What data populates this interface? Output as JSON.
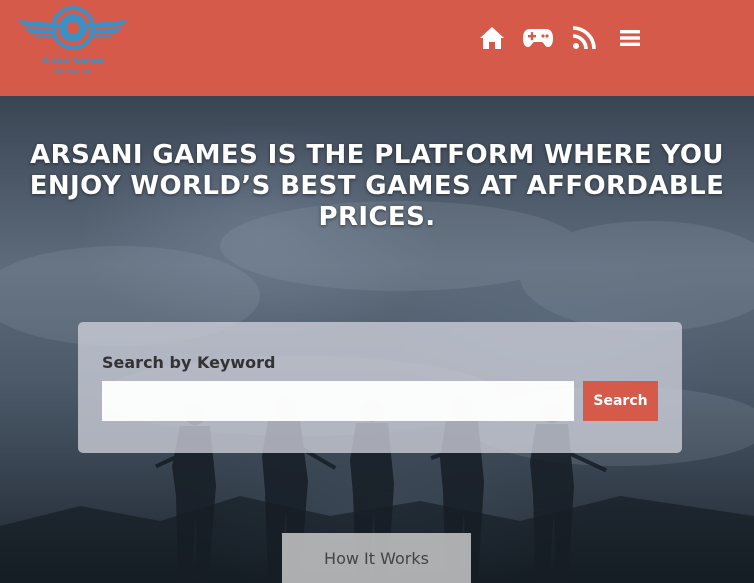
{
  "header": {
    "logo": {
      "name_line1": "Arsani Games",
      "name_line2": "Games Inc",
      "initial": "G"
    },
    "nav": [
      {
        "icon": "home-icon"
      },
      {
        "icon": "gamepad-icon"
      },
      {
        "icon": "rss-icon"
      },
      {
        "icon": "menu-icon"
      }
    ],
    "background_color": "#d65a4a"
  },
  "hero": {
    "tagline": "ARSANI GAMES IS THE PLATFORM WHERE YOU ENJOY WORLD’S BEST GAMES AT AFFORDABLE PRICES."
  },
  "search": {
    "label": "Search by Keyword",
    "input_value": "",
    "placeholder": "",
    "button_label": "Search",
    "button_color": "#d65a4a"
  },
  "how_it_works": {
    "label": "How It Works"
  }
}
